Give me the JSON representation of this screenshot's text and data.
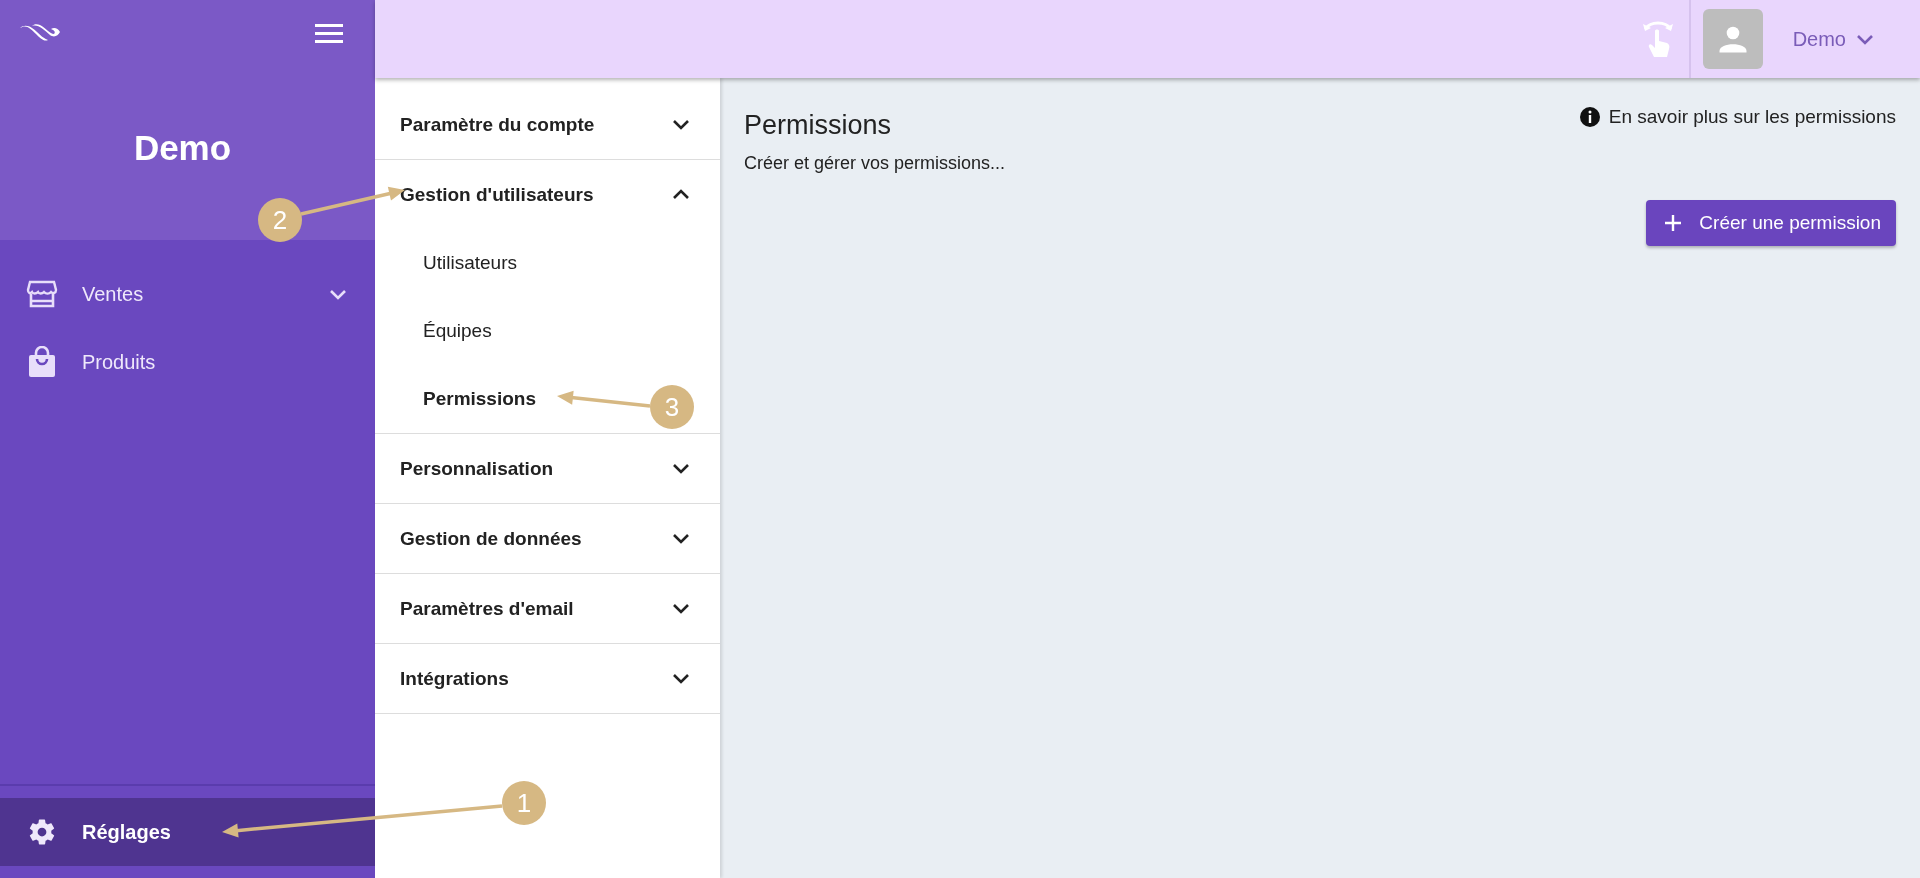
{
  "sidebar": {
    "account_name": "Demo",
    "items": [
      {
        "label": "Ventes",
        "expandable": true,
        "selected": false
      },
      {
        "label": "Produits",
        "expandable": false,
        "selected": false
      }
    ],
    "footer_item": {
      "label": "Réglages",
      "selected": true
    }
  },
  "top_bar": {
    "user_name": "Demo"
  },
  "settings_menu": {
    "sections": [
      {
        "label": "Paramètre du compte",
        "expanded": false
      },
      {
        "label": "Gestion d'utilisateurs",
        "expanded": true,
        "children": [
          {
            "label": "Utilisateurs",
            "selected": false
          },
          {
            "label": "Équipes",
            "selected": false
          },
          {
            "label": "Permissions",
            "selected": true
          }
        ]
      },
      {
        "label": "Personnalisation",
        "expanded": false
      },
      {
        "label": "Gestion de données",
        "expanded": false
      },
      {
        "label": "Paramètres d'email",
        "expanded": false
      },
      {
        "label": "Intégrations",
        "expanded": false
      }
    ]
  },
  "main": {
    "title": "Permissions",
    "subtitle": "Créer et gérer vos permissions...",
    "help_link": "En savoir plus sur les permissions",
    "create_button": "Créer une permission"
  },
  "annotations": [
    {
      "number": "1"
    },
    {
      "number": "2"
    },
    {
      "number": "3"
    }
  ]
}
